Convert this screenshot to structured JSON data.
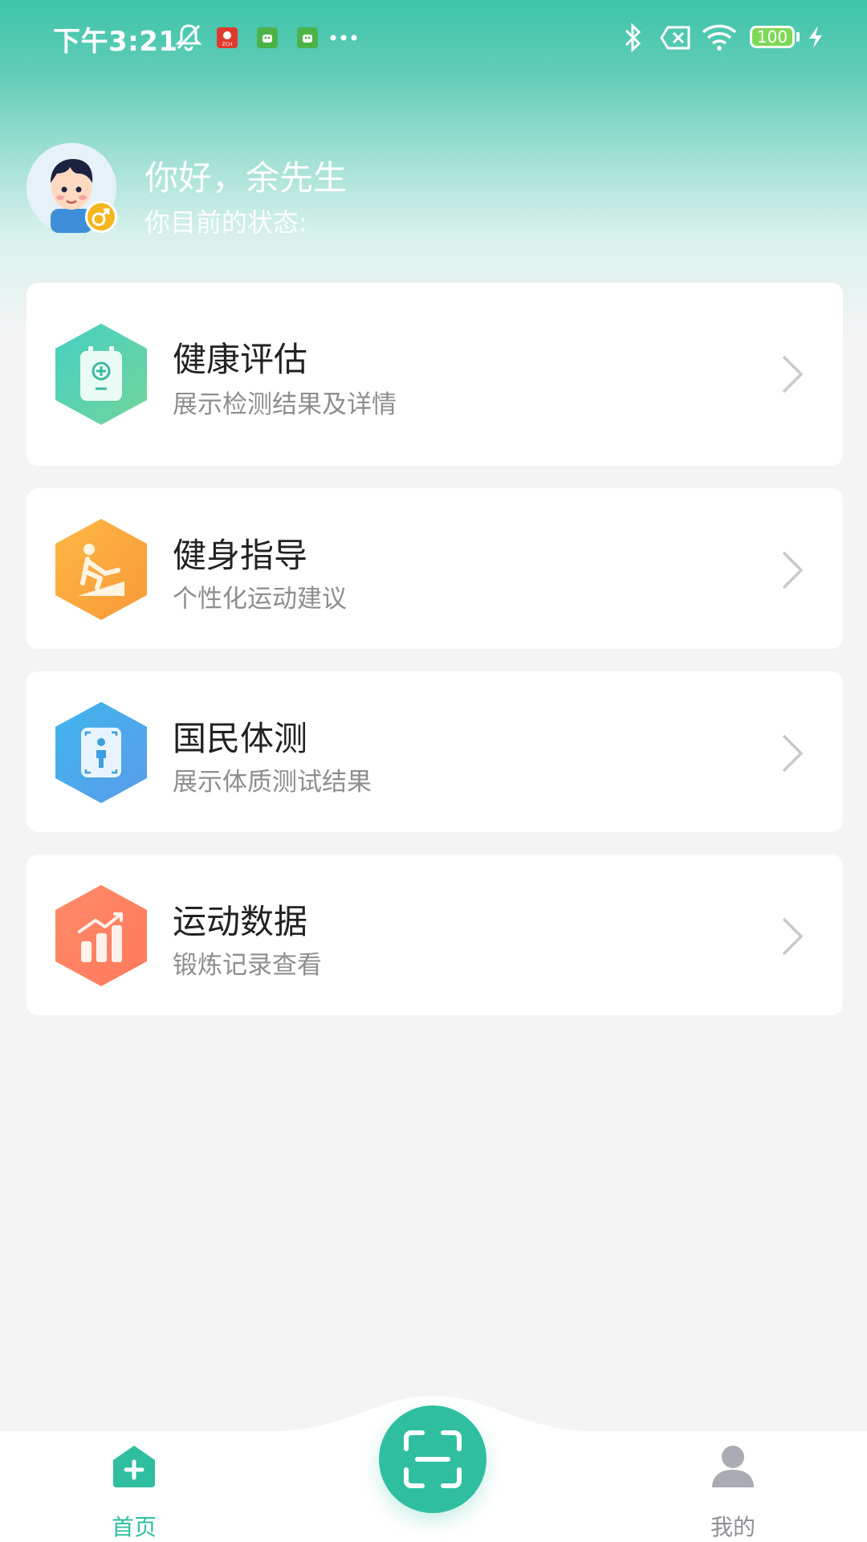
{
  "status_bar": {
    "time": "下午3:21",
    "battery": "100",
    "app_badge_1_text": "ZCH",
    "icons": [
      "bell-off-icon",
      "app-badge-icon",
      "android-icon",
      "android-icon",
      "more-icon",
      "bluetooth-icon",
      "sim-off-icon",
      "wifi-icon",
      "battery-icon",
      "charging-icon"
    ]
  },
  "profile": {
    "greeting": "你好，余先生",
    "status_label": "你目前的状态:",
    "gender_icon": "male-icon"
  },
  "cards": [
    {
      "title": "健康评估",
      "subtitle": "展示检测结果及详情",
      "icon": "health-clipboard-icon",
      "color": "#48c9a5"
    },
    {
      "title": "健身指导",
      "subtitle": "个性化运动建议",
      "icon": "fitness-icon",
      "color": "#f7a53a"
    },
    {
      "title": "国民体测",
      "subtitle": "展示体质测试结果",
      "icon": "body-scan-icon",
      "color": "#45a9ec"
    },
    {
      "title": "运动数据",
      "subtitle": "锻炼记录查看",
      "icon": "chart-icon",
      "color": "#ff7f5f"
    }
  ],
  "bottom_nav": {
    "home_label": "首页",
    "mine_label": "我的",
    "scan_icon": "scan-icon"
  },
  "colors": {
    "accent": "#2fbfa0",
    "inactive": "#a9acb3"
  }
}
